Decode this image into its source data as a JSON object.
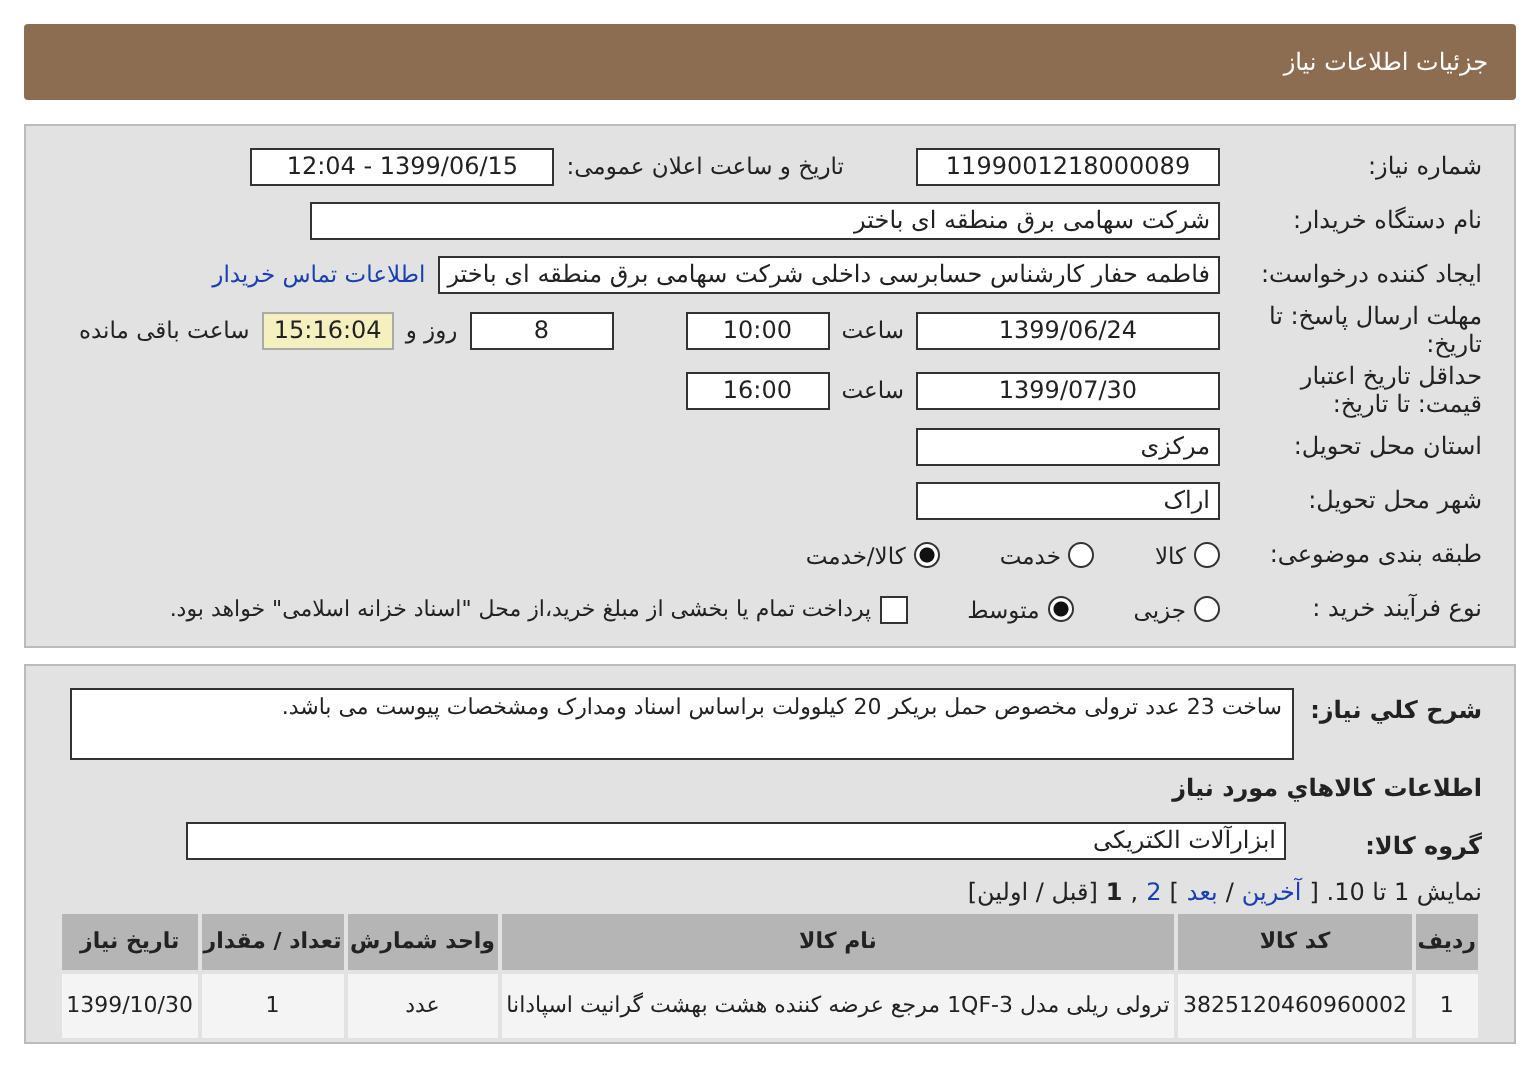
{
  "header": {
    "title": "جزئیات اطلاعات نیاز"
  },
  "form": {
    "need_number": {
      "label": "شماره نیاز:",
      "value": "1199001218000089"
    },
    "announce": {
      "label": "تاریخ و ساعت اعلان عمومی:",
      "value": "1399/06/15 - 12:04"
    },
    "buyer": {
      "label": "نام دستگاه خریدار:",
      "value": "شرکت سهامی برق منطقه ای باختر"
    },
    "creator": {
      "label": "ایجاد کننده درخواست:",
      "value": "فاطمه حفار کارشناس حسابرسی داخلی شرکت سهامی برق منطقه ای باختر",
      "link": "اطلاعات تماس خریدار"
    },
    "deadline": {
      "label": "مهلت ارسال پاسخ: تا تاریخ:",
      "date": "1399/06/24",
      "time_label": "ساعت",
      "time": "10:00",
      "days": "8",
      "days_label": "روز و",
      "remaining": "15:16:04",
      "remaining_label": "ساعت باقی مانده"
    },
    "validity": {
      "label": "حداقل تاریخ اعتبار قیمت: تا تاریخ:",
      "date": "1399/07/30",
      "time_label": "ساعت",
      "time": "16:00"
    },
    "province": {
      "label": "استان محل تحویل:",
      "value": "مرکزی"
    },
    "city": {
      "label": "شهر محل تحویل:",
      "value": "اراک"
    },
    "category": {
      "label": "طبقه بندی موضوعی:",
      "options": [
        {
          "label": "کالا",
          "selected": false
        },
        {
          "label": "خدمت",
          "selected": false
        },
        {
          "label": "کالا/خدمت",
          "selected": true
        }
      ]
    },
    "process": {
      "label": "نوع فرآیند خرید :",
      "options": [
        {
          "label": "جزیی",
          "selected": false
        },
        {
          "label": "متوسط",
          "selected": true
        }
      ],
      "treasury": {
        "label": "پرداخت تمام یا بخشی از مبلغ خرید،از محل \"اسناد خزانه اسلامی\" خواهد بود.",
        "checked": false
      }
    }
  },
  "details": {
    "description": {
      "label": "شرح کلي نياز:",
      "value": "ساخت 23 عدد ترولی مخصوص حمل بریکر 20 کیلوولت براساس اسناد ومدارک ومشخصات پیوست می باشد."
    },
    "goods_heading": "اطلاعات کالاهاي مورد نياز",
    "group": {
      "label": "گروه کالا:",
      "value": "ابزارآلات الکتریکی"
    },
    "pagination": [
      {
        "kind": "text",
        "text": "نمایش 1 تا 10. ["
      },
      {
        "kind": "link",
        "text": "آخرین"
      },
      {
        "kind": "text",
        "text": "/"
      },
      {
        "kind": "link",
        "text": "بعد"
      },
      {
        "kind": "text",
        "text": "]"
      },
      {
        "kind": "link",
        "text": "2"
      },
      {
        "kind": "text",
        "text": ","
      },
      {
        "kind": "current",
        "text": "1"
      },
      {
        "kind": "text",
        "text": "[قبل / اولین]"
      }
    ],
    "table": {
      "columns": [
        "ردیف",
        "کد کالا",
        "نام کالا",
        "واحد شمارش",
        "تعداد / مقدار",
        "تاریخ نیاز"
      ],
      "rows": [
        [
          "1",
          "3825120460960002",
          "ترولی ریلی مدل 1QF-3 مرجع عرضه کننده هشت بهشت گرانیت اسپادانا",
          "عدد",
          "1",
          "1399/10/30"
        ]
      ]
    }
  }
}
